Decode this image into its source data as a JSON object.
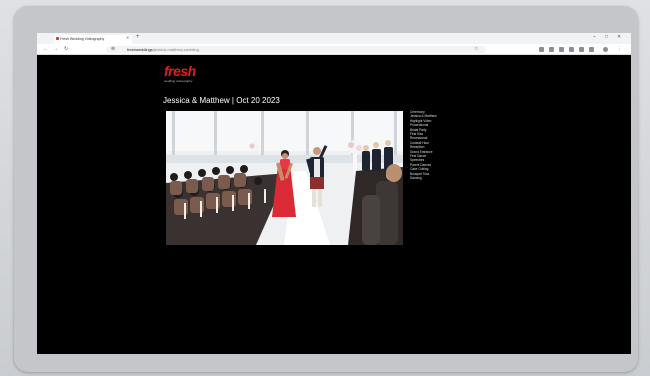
{
  "browser": {
    "tab_title": "Fresh Wedding Videography",
    "url_domain": "freshweddings",
    "url_path": "/jessica-matthew-wedding"
  },
  "site": {
    "logo_text": "fresh",
    "logo_tagline": "wedding videography"
  },
  "page": {
    "title": "Jessica & Matthew | Oct 20 2023"
  },
  "sidebar": {
    "links": [
      "Ceremony",
      "Jessica & Matthew",
      "Highlight Video",
      "Processional",
      "Bridal Party",
      "First Kiss",
      "Recessional",
      "Cocktail Hour",
      "Reception",
      "Grand Entrance",
      "First Dance",
      "Speeches",
      "Parent Dances",
      "Cake Cutting",
      "Bouquet Toss",
      "Dancing"
    ]
  },
  "colors": {
    "logo": "#e0201a",
    "background": "#000000",
    "page_title": "#ffffff"
  }
}
